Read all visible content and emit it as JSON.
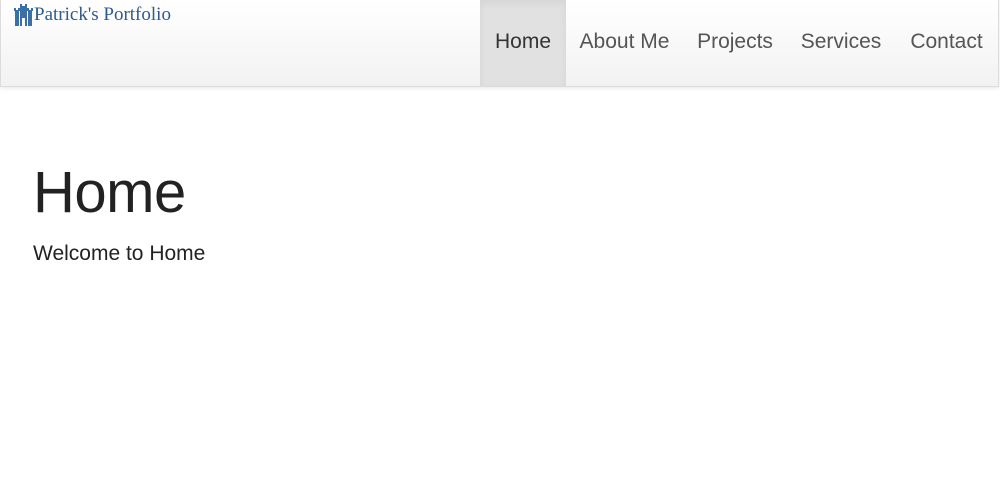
{
  "brand": {
    "name": "Patrick's Portfolio",
    "icon": "castle-icon",
    "color": "#2e5a8e"
  },
  "nav": {
    "items": [
      {
        "label": "Home",
        "active": true
      },
      {
        "label": "About Me",
        "active": false
      },
      {
        "label": "Projects",
        "active": false
      },
      {
        "label": "Services",
        "active": false
      },
      {
        "label": "Contact",
        "active": false
      }
    ]
  },
  "main": {
    "title": "Home",
    "subtitle": "Welcome to Home"
  }
}
